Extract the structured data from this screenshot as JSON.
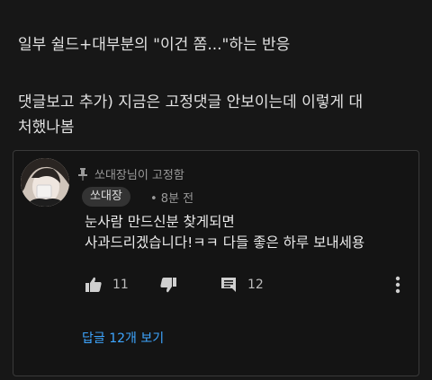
{
  "post": {
    "line1": "일부 쉴드+대부분의 \"이건 쫌...\"하는 반응",
    "line2": "댓글보고 추가) 지금은 고정댓글 안보이는데 이렇게 대",
    "line3": "처했나봄"
  },
  "comment": {
    "pinned_label": "쏘대장님이 고정함",
    "author": "쏘대장",
    "time": "• 8분 전",
    "text_line1": "눈사람 만드신분 찾게되면",
    "text_line2": "사과드리겠습니다!ㅋㅋ 다들 좋은 하루 보내세용",
    "like_count": "11",
    "reply_count": "12",
    "view_replies": "답글 12개 보기"
  },
  "icons": {
    "pin": "pin-icon",
    "like": "thumbs-up-icon",
    "dislike": "thumbs-down-icon",
    "reply": "comment-icon",
    "more": "more-vertical-icon"
  },
  "colors": {
    "background": "#171717",
    "link": "#3ea6ff"
  }
}
